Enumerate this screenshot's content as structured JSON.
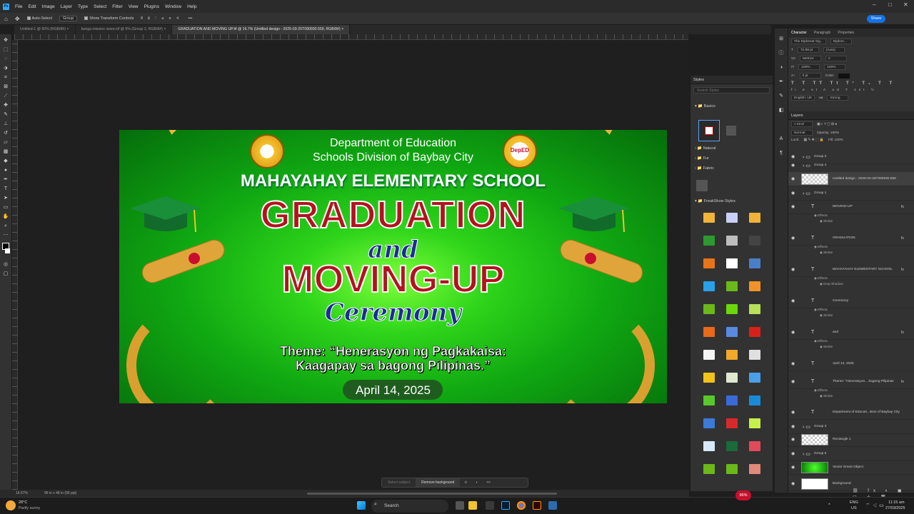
{
  "menubar": {
    "items": [
      "File",
      "Edit",
      "Image",
      "Layer",
      "Type",
      "Select",
      "Filter",
      "View",
      "Plugins",
      "Window",
      "Help"
    ]
  },
  "options": {
    "auto_select": "Auto-Select",
    "group": "Group",
    "transform": "Show Transform Controls",
    "share": "Share"
  },
  "tabs": [
    {
      "label": "Untitled-1 @ 50% (RGB/8#) ×"
    },
    {
      "label": "bunga mission vision.tif @ 5% (Group 2, RGB/8#) ×"
    },
    {
      "label": "GRADUATION AND MOVING UP.tif @ 16.7% (Untitled design - 2025-03-25T090930.559, RGB/8#) ×"
    }
  ],
  "artwork": {
    "dep1": "Department of Education",
    "dep2": "Schools Division of Baybay City",
    "school": "MAHAYAHAY ELEMENTARY SCHOOL",
    "grad": "GRADUATION",
    "and": "and",
    "moving": "MOVING-UP",
    "ceremony": "Ceremony",
    "theme1": "Theme: “Henerasyon ng Pagkakaisa:",
    "theme2": "Kaagapay sa bagong Pilipinas.”",
    "date": "April 14, 2025",
    "seal_right": "DepED"
  },
  "styles": {
    "title": "Styles",
    "search": "Search Styles",
    "groups": [
      "Basics",
      "Natural",
      "Fur",
      "Fabric",
      "FreakShow Styles"
    ]
  },
  "character": {
    "tabs": [
      "Character",
      "Paragraph",
      "Properties"
    ],
    "font": "The Diplomat Sig...",
    "style": "Diplom...",
    "size": "72.98 pt",
    "leading": "(Auto)",
    "kerning": "Metrics",
    "tracking": "0",
    "vscale": "100%",
    "hscale": "100%",
    "baseline": "0 pt",
    "color_label": "Color:",
    "lang": "English: UK",
    "aa": "Strong"
  },
  "layers": {
    "title": "Layers",
    "kind": "Kind",
    "normal": "Normal",
    "opacity": "Opacity: 100%",
    "lock": "Lock:",
    "fill": "Fill: 100%",
    "rows": [
      {
        "name": "Group 2",
        "kind": "group"
      },
      {
        "name": "Group 4",
        "kind": "group"
      },
      {
        "name": "Untitled design - 2025-03-25T090930.559",
        "kind": "thumb"
      },
      {
        "name": "Group 1",
        "kind": "group"
      },
      {
        "name": "MOVING-UP",
        "kind": "text"
      },
      {
        "name": "GRADUATION",
        "kind": "text"
      },
      {
        "name": "MAHAYAHAY ELEMENTARY SCHOOL",
        "kind": "text"
      },
      {
        "name": "Ceremony",
        "kind": "text"
      },
      {
        "name": "and",
        "kind": "text"
      },
      {
        "name": "April 14, 2025",
        "kind": "text"
      },
      {
        "name": "Theme: \"Henerasyon... bagong Pilipinas",
        "kind": "text"
      },
      {
        "name": "Department of Educati...ision of Baybay City",
        "kind": "text"
      },
      {
        "name": "Group 3",
        "kind": "group"
      },
      {
        "name": "Rectangle 1",
        "kind": "thumb"
      },
      {
        "name": "Group 5",
        "kind": "group"
      },
      {
        "name": "Vector Smart Object",
        "kind": "thumb"
      },
      {
        "name": "Background",
        "kind": "thumb"
      }
    ],
    "effects": "Effects",
    "stroke": "Stroke",
    "drop": "Drop Shadow",
    "fx": "fx"
  },
  "status": {
    "zoom": "16.67%",
    "size": "96 in x 48 in (96 ppi)"
  },
  "contextbar": {
    "select": "Select subject",
    "remove": "Remove background"
  },
  "taskbar": {
    "weather_temp": "28°C",
    "weather_desc": "Partly sunny",
    "search": "Search",
    "lang": "ENG",
    "region": "US",
    "time": "11:15 am",
    "date": "27/03/2025",
    "badge": "96%"
  }
}
